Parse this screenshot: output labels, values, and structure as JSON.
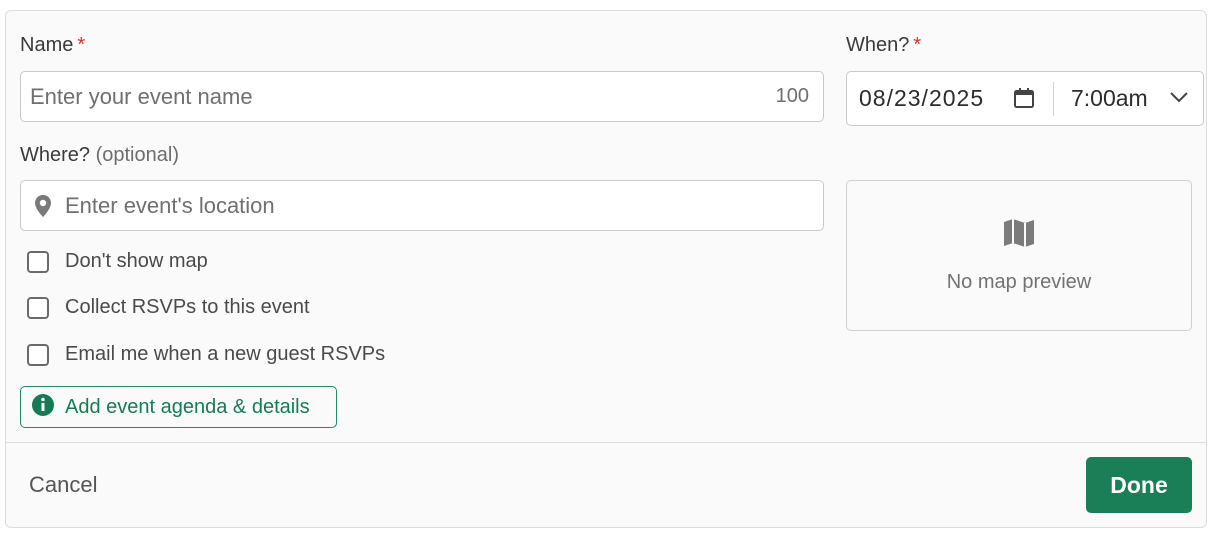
{
  "form": {
    "name_label": "Name",
    "name_required": "*",
    "name_placeholder": "Enter your event name",
    "name_counter": "100",
    "when_label": "When?",
    "when_required": "*",
    "date_value": "08/23/2025",
    "time_value": "7:00am",
    "where_label": "Where?",
    "where_optional": "(optional)",
    "location_placeholder": "Enter event's location",
    "checkboxes": [
      {
        "label": "Don't show map",
        "checked": false
      },
      {
        "label": "Collect RSVPs to this event",
        "checked": false
      },
      {
        "label": "Email me when a new guest RSVPs",
        "checked": false
      }
    ],
    "agenda_button": "Add event agenda & details"
  },
  "map": {
    "empty_text": "No map preview"
  },
  "footer": {
    "cancel_label": "Cancel",
    "done_label": "Done"
  },
  "colors": {
    "accent": "#1a7f56",
    "required": "#d0342c"
  },
  "icons": {
    "calendar": "calendar-icon",
    "chevron": "chevron-down-icon",
    "location": "map-pin-icon",
    "info": "info-icon",
    "map": "map-icon"
  }
}
